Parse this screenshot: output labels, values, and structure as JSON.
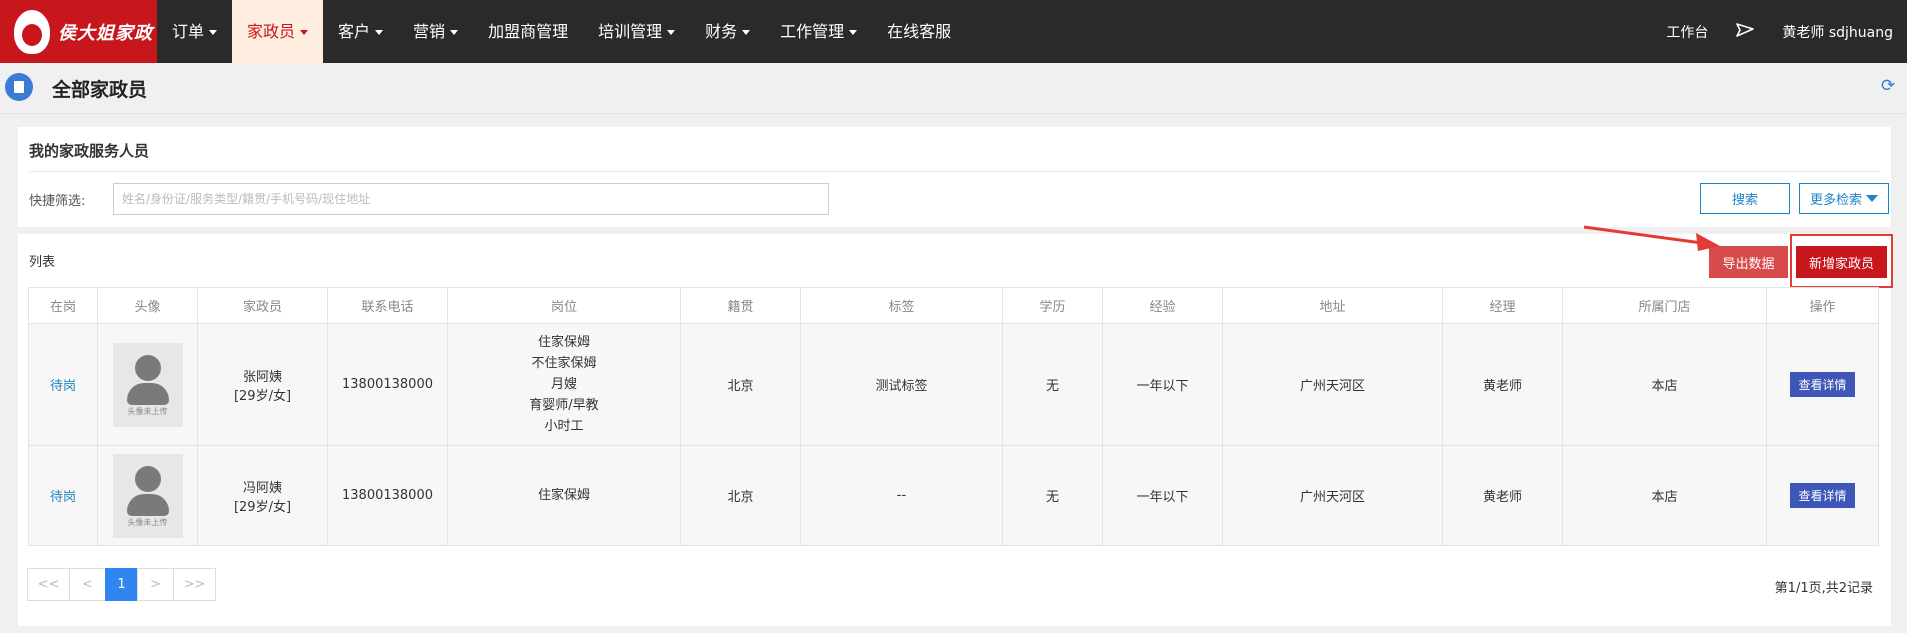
{
  "brand": {
    "logo_text": "侯大姐家政"
  },
  "nav": {
    "items": [
      {
        "label": "订单",
        "dropdown": true,
        "active": false
      },
      {
        "label": "家政员",
        "dropdown": true,
        "active": true
      },
      {
        "label": "客户",
        "dropdown": true,
        "active": false
      },
      {
        "label": "营销",
        "dropdown": true,
        "active": false
      },
      {
        "label": "加盟商管理",
        "dropdown": false,
        "active": false
      },
      {
        "label": "培训管理",
        "dropdown": true,
        "active": false
      },
      {
        "label": "财务",
        "dropdown": true,
        "active": false
      },
      {
        "label": "工作管理",
        "dropdown": true,
        "active": false
      },
      {
        "label": "在线客服",
        "dropdown": false,
        "active": false
      }
    ],
    "right": {
      "workbench": "工作台",
      "user": "黄老师 sdjhuang"
    }
  },
  "page": {
    "title": "全部家政员"
  },
  "filter": {
    "title": "我的家政服务人员",
    "label": "快捷筛选:",
    "placeholder": "姓名/身份证/服务类型/籍贯/手机号码/现住地址",
    "value": "",
    "search_label": "搜索",
    "more_label": "更多检索"
  },
  "list": {
    "label": "列表",
    "export_label": "导出数据",
    "add_label": "新增家政员",
    "columns": [
      "在岗",
      "头像",
      "家政员",
      "联系电话",
      "岗位",
      "籍贯",
      "标签",
      "学历",
      "经验",
      "地址",
      "经理",
      "所属门店",
      "操作"
    ],
    "avatar_caption": "头像未上传",
    "detail_label": "查看详情",
    "rows": [
      {
        "status": "待岗",
        "name": "张阿姨",
        "info": "[29岁/女]",
        "phone": "13800138000",
        "positions": [
          "住家保姆",
          "不住家保姆",
          "月嫂",
          "育婴师/早教",
          "小时工"
        ],
        "origin": "北京",
        "tags": "测试标签",
        "education": "无",
        "experience": "一年以下",
        "address": "广州天河区",
        "manager": "黄老师",
        "store": "本店"
      },
      {
        "status": "待岗",
        "name": "冯阿姨",
        "info": "[29岁/女]",
        "phone": "13800138000",
        "positions": [
          "住家保姆"
        ],
        "origin": "北京",
        "tags": "--",
        "education": "无",
        "experience": "一年以下",
        "address": "广州天河区",
        "manager": "黄老师",
        "store": "本店"
      }
    ]
  },
  "pagination": {
    "first": "<<",
    "prev": "<",
    "current": "1",
    "next": ">",
    "last": ">>",
    "info": "第1/1页,共2记录"
  },
  "colors": {
    "brand_red": "#c8161d",
    "nav_bg": "#2a2a2a",
    "link_blue": "#1c84c6",
    "detail_btn": "#3d56b8",
    "page_blue": "#2f86f0"
  }
}
